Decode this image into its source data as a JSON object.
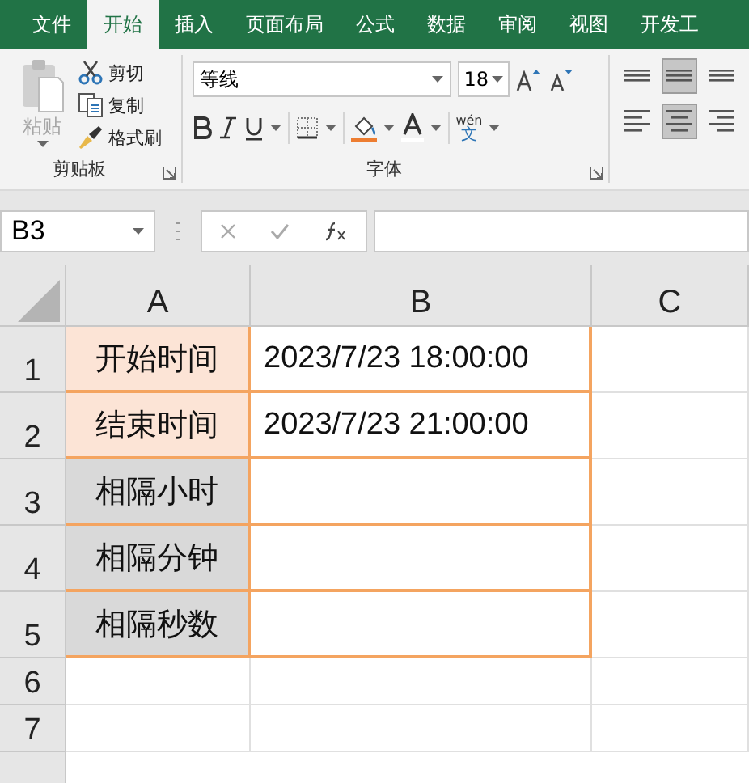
{
  "tabs": [
    {
      "label": "文件",
      "selected": false
    },
    {
      "label": "开始",
      "selected": true
    },
    {
      "label": "插入",
      "selected": false
    },
    {
      "label": "页面布局",
      "selected": false
    },
    {
      "label": "公式",
      "selected": false
    },
    {
      "label": "数据",
      "selected": false
    },
    {
      "label": "审阅",
      "selected": false
    },
    {
      "label": "视图",
      "selected": false
    },
    {
      "label": "开发工",
      "selected": false
    }
  ],
  "clipboard": {
    "title": "剪贴板",
    "paste": {
      "label": "粘贴",
      "disabled": true
    },
    "items": [
      {
        "kind": "cut",
        "label": "剪切"
      },
      {
        "kind": "copy",
        "label": "复制"
      },
      {
        "kind": "brush",
        "label": "格式刷"
      }
    ]
  },
  "font": {
    "title": "字体",
    "font_name": "等线",
    "font_size": "18",
    "phonetic": {
      "top": "wén",
      "bottom": "文"
    }
  },
  "alignment": {
    "rows": [
      [
        {
          "kind": "top",
          "selected": false
        },
        {
          "kind": "middle",
          "selected": true
        },
        {
          "kind": "bottom",
          "selected": false
        }
      ],
      [
        {
          "kind": "left",
          "selected": false
        },
        {
          "kind": "center",
          "selected": true
        },
        {
          "kind": "right",
          "selected": false
        }
      ]
    ]
  },
  "formula_bar": {
    "name_box": "B3"
  },
  "sheet": {
    "columns": [
      "A",
      "B",
      "C"
    ],
    "rows": [
      {
        "number": "1",
        "cells": [
          {
            "text": "开始时间",
            "color": "#fce4d6"
          },
          {
            "text": "2023/7/23 18:00:00"
          }
        ]
      },
      {
        "number": "2",
        "cells": [
          {
            "text": "结束时间",
            "color": "#fce4d6"
          },
          {
            "text": "2023/7/23 21:00:00"
          }
        ]
      },
      {
        "number": "3",
        "cells": [
          {
            "text": "相隔小时",
            "color": "#d9d9d9"
          },
          {}
        ]
      },
      {
        "number": "4",
        "cells": [
          {
            "text": "相隔分钟",
            "color": "#d9d9d9"
          },
          {}
        ]
      },
      {
        "number": "5",
        "cells": [
          {
            "text": "相隔秒数",
            "color": "#d9d9d9"
          },
          {}
        ]
      },
      {
        "number": "6",
        "cells": []
      },
      {
        "number": "7",
        "cells": []
      }
    ]
  }
}
